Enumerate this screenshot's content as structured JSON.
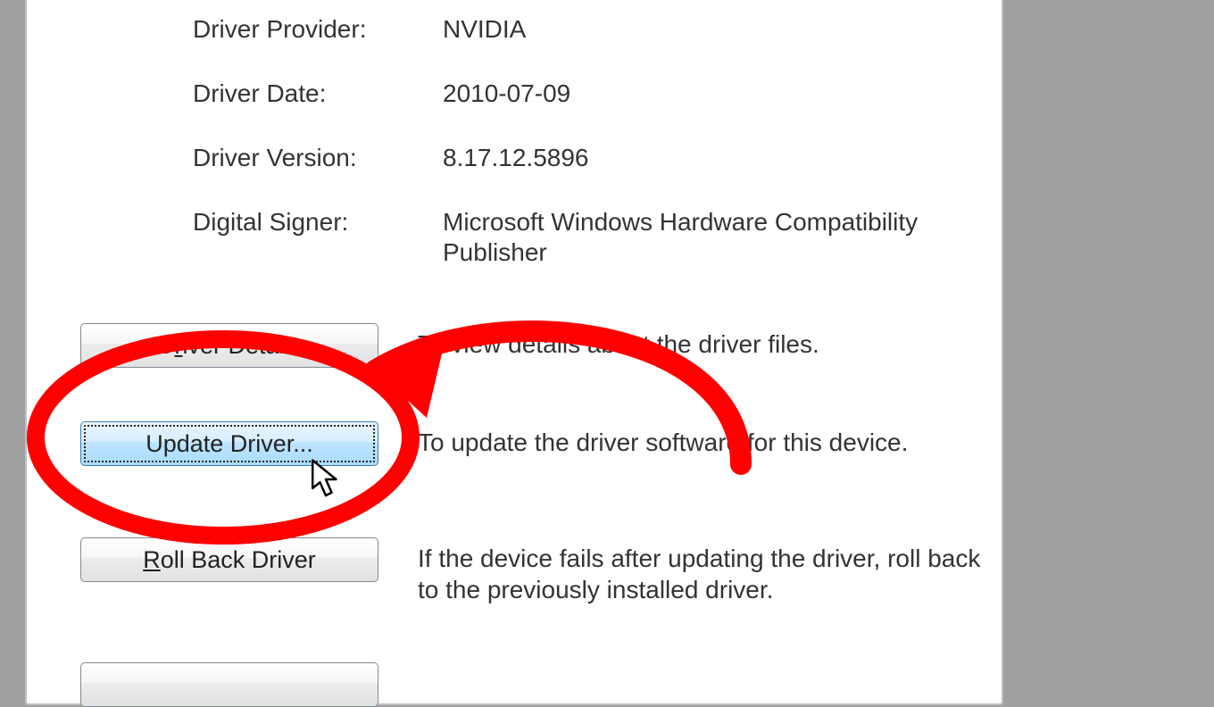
{
  "driver_info": {
    "provider_label": "Driver Provider:",
    "provider_value": "NVIDIA",
    "date_label": "Driver Date:",
    "date_value": "2010-07-09",
    "version_label": "Driver Version:",
    "version_value": "8.17.12.5896",
    "signer_label": "Digital Signer:",
    "signer_value": "Microsoft Windows Hardware Compatibility Publisher"
  },
  "buttons": {
    "details": {
      "prefix": "D",
      "mid": "r",
      "suffix": "iver Details",
      "desc": "To view details about the driver files."
    },
    "update": {
      "label": "Update Driver...",
      "desc": "To update the driver software for this device."
    },
    "rollback": {
      "prefix": "",
      "mid": "R",
      "suffix": "oll Back Driver",
      "desc": "If the device fails after updating the driver, roll back to the previously installed driver."
    }
  },
  "annotation": {
    "color": "#ff0000"
  }
}
